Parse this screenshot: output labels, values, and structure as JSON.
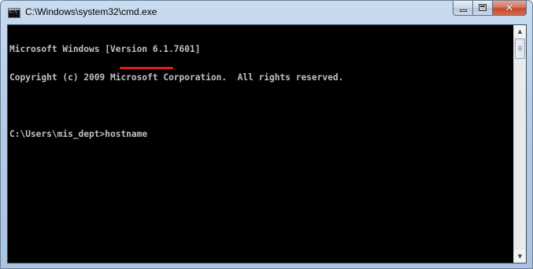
{
  "window": {
    "title": "C:\\Windows\\system32\\cmd.exe",
    "icon_text": "C:\\"
  },
  "console": {
    "lines": [
      "Microsoft Windows [Version 6.1.7601]",
      "Copyright (c) 2009 Microsoft Corporation.  All rights reserved.",
      "",
      "C:\\Users\\mis_dept>hostname"
    ]
  },
  "icons": [
    "cmd-app-icon",
    "minimize-icon",
    "maximize-icon",
    "close-icon",
    "scroll-up-arrow-icon",
    "scroll-down-arrow-icon"
  ],
  "colors": {
    "console_bg": "#000000",
    "console_text": "#c0c0c0",
    "highlight_underline": "#e11b1b",
    "close_button": "#c44a2e"
  }
}
